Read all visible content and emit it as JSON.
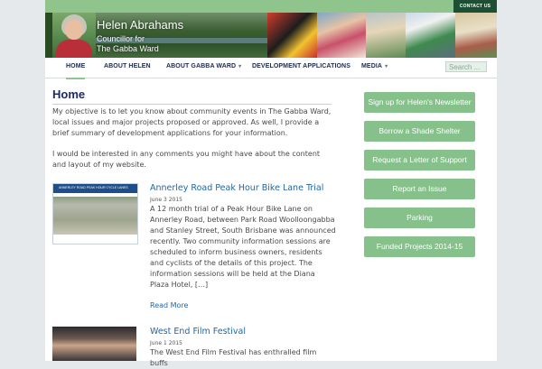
{
  "top_bar": {
    "contact_label": "CONTACT US"
  },
  "header": {
    "site_name": "Helen Abrahams",
    "tagline_1": "Councillor for",
    "tagline_2": "The Gabba Ward"
  },
  "nav": {
    "items": [
      {
        "label": "HOME"
      },
      {
        "label": "ABOUT HELEN"
      },
      {
        "label": "ABOUT GABBA WARD",
        "caret": "▾"
      },
      {
        "label": "DEVELOPMENT APPLICATIONS"
      },
      {
        "label": "MEDIA",
        "caret": "▾"
      }
    ],
    "search_placeholder": "Search ..."
  },
  "main": {
    "page_title": "Home",
    "intro_p1": "My objective is to let you know about community events in The Gabba Ward, local issues and major projects proposed or approved. As well, I provide a brief summary of development applications for your information.",
    "intro_p2": "I would be interested in any comments you might have about the content and layout of my website.",
    "posts": [
      {
        "title": "Annerley Road Peak Hour Bike Lane Trial",
        "date": "June 3 2015",
        "thumb_caption": "ANNERLEY ROAD PEAK HOUR CYCLE LANES",
        "excerpt": "A 12 month trial of a Peak Hour Bike Lane on Annerley Road, between Park Road Woolloongabba and Stanley Street, South Brisbane was announced recently. Two community information sessions are scheduled to inform business owners, residents and cyclists of the details of this project. The information sessions will be held at the Diana Plaza Hotel, […]",
        "read_more": "Read More"
      },
      {
        "title": "West End Film Festival",
        "date": "June 1 2015",
        "excerpt": "The West End Film Festival has enthralled film buffs"
      }
    ]
  },
  "sidebar": {
    "buttons": [
      {
        "label": "Sign up for Helen's Newsletter"
      },
      {
        "label": "Borrow a Shade Shelter"
      },
      {
        "label": "Request a Letter of Support"
      },
      {
        "label": "Report an Issue"
      },
      {
        "label": "Parking"
      },
      {
        "label": "Funded Projects 2014-15"
      }
    ]
  },
  "colors": {
    "accent_green": "#8fc48c",
    "button_green": "#86c08a",
    "link_blue": "#2167a8",
    "title_navy": "#1c2a62",
    "contact_dark_green": "#1d4f33"
  }
}
